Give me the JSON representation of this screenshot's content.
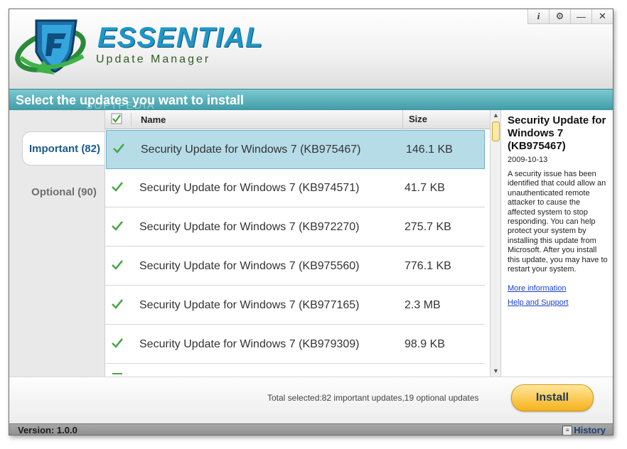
{
  "app": {
    "brand_title": "ESSENTIAL",
    "brand_subtitle": "Update Manager",
    "window_buttons": [
      "i",
      "⚙",
      "—",
      "✕"
    ]
  },
  "banner": {
    "title": "Select the updates you want to install",
    "watermark": "SOFTPEDIA"
  },
  "tabs": [
    {
      "label": "Important (82)",
      "active": true
    },
    {
      "label": "Optional (90)",
      "active": false
    }
  ],
  "list": {
    "columns": {
      "name": "Name",
      "size": "Size"
    },
    "rows": [
      {
        "name": "Security Update for Windows 7 (KB975467)",
        "size": "146.1 KB",
        "checked": true,
        "selected": true
      },
      {
        "name": "Security Update for Windows 7 (KB974571)",
        "size": "41.7 KB",
        "checked": true,
        "selected": false
      },
      {
        "name": "Security Update for Windows 7 (KB972270)",
        "size": "275.7 KB",
        "checked": true,
        "selected": false
      },
      {
        "name": "Security Update for Windows 7 (KB975560)",
        "size": "776.1 KB",
        "checked": true,
        "selected": false
      },
      {
        "name": "Security Update for Windows 7 (KB977165)",
        "size": "2.3 MB",
        "checked": true,
        "selected": false
      },
      {
        "name": "Security Update for Windows 7 (KB979309)",
        "size": "98.9 KB",
        "checked": true,
        "selected": false
      }
    ]
  },
  "detail": {
    "title": "Security Update for Windows 7 (KB975467)",
    "date": "2009-10-13",
    "description": "A security issue has been identified that could allow an unauthenticated remote attacker to cause the affected system to stop responding. You can help protect your system by installing this update from Microsoft. After you install this update, you may have to restart your system.",
    "more_info": "More information",
    "help_support": "Help and Support"
  },
  "footer": {
    "total": "Total selected:82 important updates,19 optional updates",
    "install_label": "Install"
  },
  "status": {
    "version": "Version: 1.0.0",
    "history": "History"
  },
  "colors": {
    "accent_teal": "#3e9aa6",
    "brand_blue": "#1e97c8",
    "install_orange": "#f6b21c",
    "selection_blue": "#b6dce8"
  }
}
